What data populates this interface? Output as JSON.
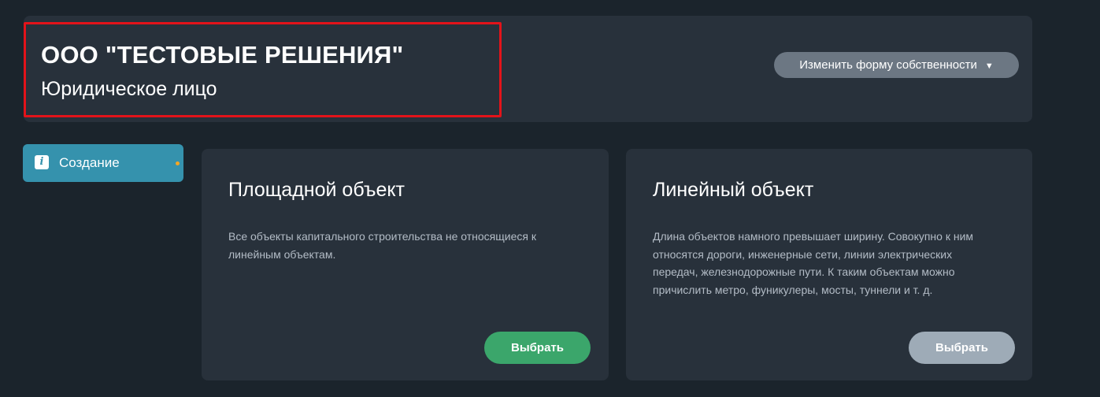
{
  "header": {
    "org_name": "ООО \"ТЕСТОВЫЕ РЕШЕНИЯ\"",
    "org_type": "Юридическое лицо",
    "change_button_label": "Изменить форму собственности",
    "change_button_caret": "▼",
    "highlight_color": "#e3131a"
  },
  "sidebar": {
    "items": [
      {
        "label": "Создание",
        "icon": "info-icon",
        "icon_glyph": "i",
        "active": true,
        "indicator_color": "#f5a623"
      }
    ]
  },
  "cards": [
    {
      "title": "Площадной объект",
      "description": "Все объекты капитального строительства не относящиеся к линейным объектам.",
      "button_label": "Выбрать",
      "button_color": "#3ba66b"
    },
    {
      "title": "Линейный объект",
      "description": "Длина объектов намного превышает ширину. Совокупно к ним относятся дороги, инженерные сети, линии электрических передач, железнодорожные пути. К таким объектам можно причислить метро, фуникулеры, мосты, туннели и т. д.",
      "button_label": "Выбрать",
      "button_color": "#9eabb7"
    }
  ],
  "colors": {
    "background": "#1b242c",
    "card": "#28313b",
    "accent": "#3592ad"
  }
}
